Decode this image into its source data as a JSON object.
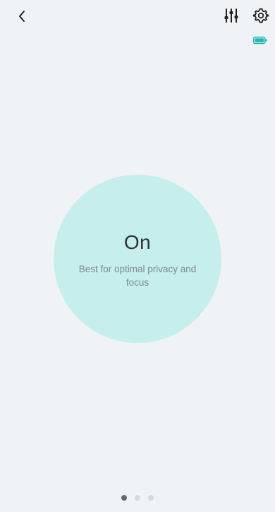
{
  "header": {
    "back_icon": "chevron-left-icon",
    "equalizer_icon": "sliders-icon",
    "settings_icon": "gear-icon"
  },
  "status": {
    "battery_icon": "battery-icon",
    "battery_color": "#24b8b0"
  },
  "mode": {
    "title": "On",
    "description": "Best for optimal privacy and focus",
    "circle_color": "#c6eeec"
  },
  "pager": {
    "pages": 3,
    "active_index": 0
  }
}
